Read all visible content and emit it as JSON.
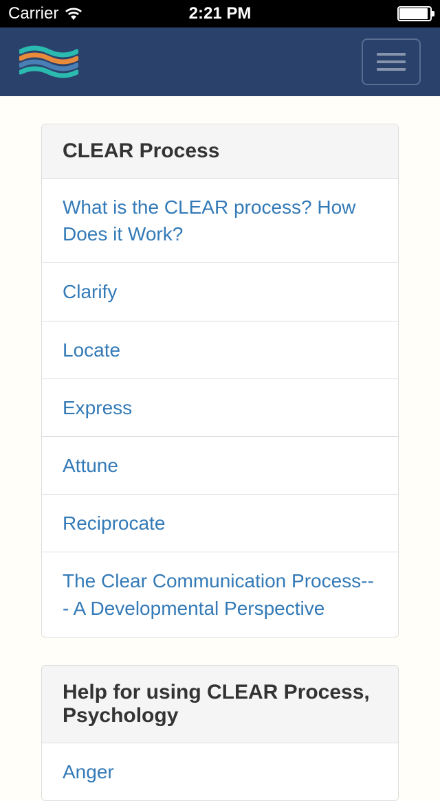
{
  "status_bar": {
    "carrier": "Carrier",
    "time": "2:21 PM"
  },
  "sections": [
    {
      "title": "CLEAR Process",
      "items": [
        "What is the CLEAR process? How Does it Work?",
        "Clarify",
        "Locate",
        "Express",
        "Attune",
        "Reciprocate",
        "The Clear Communication Process--- A Developmental Perspective"
      ]
    },
    {
      "title": "Help for using CLEAR Process, Psychology",
      "items": [
        "Anger"
      ]
    }
  ]
}
